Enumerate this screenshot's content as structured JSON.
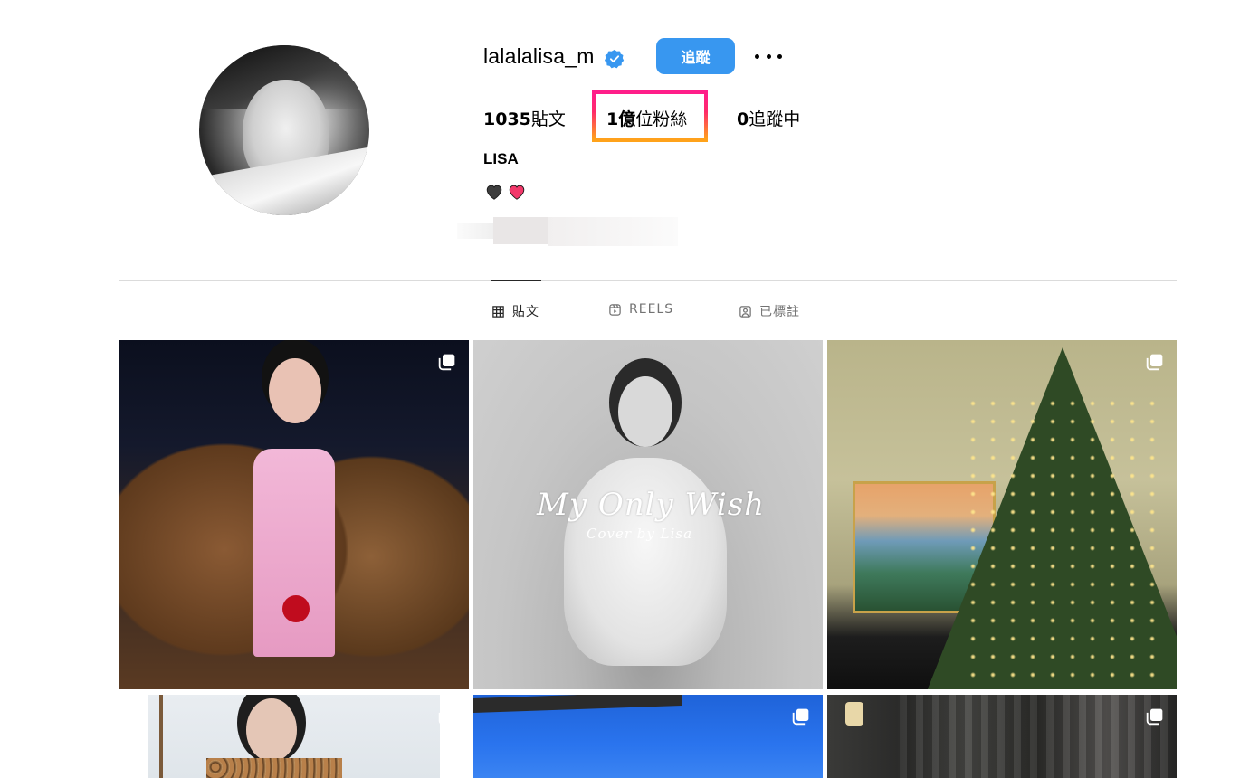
{
  "profile": {
    "username": "lalalalisa_m",
    "verified": true,
    "follow_label": "追蹤",
    "more_label": "more-options",
    "stats": {
      "posts": {
        "count": "1035",
        "label": "貼文"
      },
      "followers": {
        "count": "1億",
        "label": "位粉絲"
      },
      "following": {
        "count": "0",
        "label": "追蹤中"
      }
    },
    "display_name": "LISA",
    "bio_icons": [
      "black-heart-icon",
      "pink-heart-icon"
    ]
  },
  "tabs": [
    {
      "label": "貼文",
      "icon": "grid-icon",
      "active": true
    },
    {
      "label": "REELS",
      "icon": "reels-icon",
      "active": false
    },
    {
      "label": "已標註",
      "icon": "tagged-icon",
      "active": false
    }
  ],
  "grid": {
    "posts": [
      {
        "multi": true
      },
      {
        "multi": false,
        "overlay_title": "My Only Wish",
        "overlay_subtitle": "Cover by Lisa"
      },
      {
        "multi": true
      },
      {
        "multi": true
      },
      {
        "multi": true
      },
      {
        "multi": true
      }
    ]
  },
  "colors": {
    "accent_blue": "#3897f0",
    "highlight_gradient_top": "#ff1e8a",
    "highlight_gradient_bottom": "#ffa31a",
    "divider": "#dbdbdb"
  }
}
